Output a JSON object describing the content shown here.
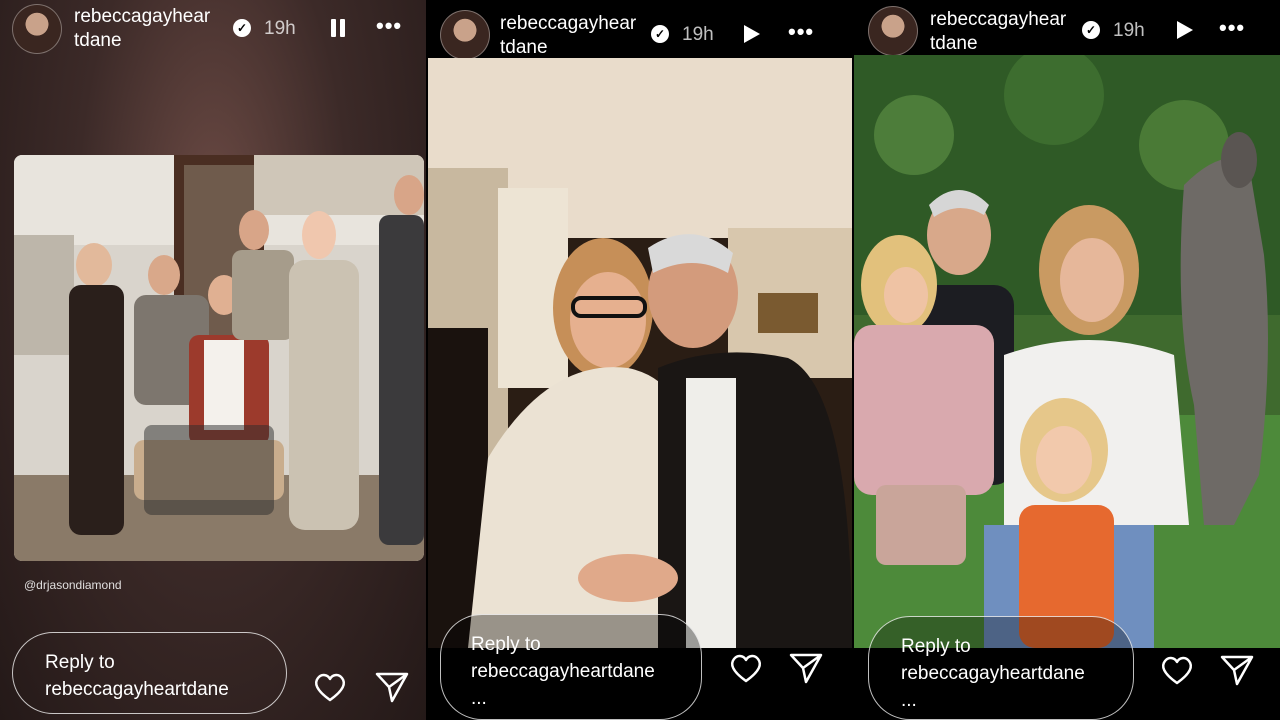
{
  "stories": [
    {
      "username": "rebeccagayheartdane",
      "username_line1": "rebeccagayhear",
      "username_line2": "tdane",
      "verified_icon": "verified-badge-icon",
      "time": "19h",
      "playback": "pause-icon",
      "more_icon": "more-options-icon",
      "photo_credit": "@drjasondiamond",
      "reply_line1": "Reply to",
      "reply_line2": "rebeccagayheartdane",
      "reply_line3": "",
      "like_icon": "heart-icon",
      "share_icon": "send-icon"
    },
    {
      "username": "rebeccagayheartdane",
      "username_line1": "rebeccagayhear",
      "username_line2": "tdane",
      "verified_icon": "verified-badge-icon",
      "time": "19h",
      "playback": "play-icon",
      "more_icon": "more-options-icon",
      "reply_line1": "Reply to",
      "reply_line2": "rebeccagayheartdane",
      "reply_line3": "...",
      "like_icon": "heart-icon",
      "share_icon": "send-icon"
    },
    {
      "username": "rebeccagayheartdane",
      "username_line1": "rebeccagayhear",
      "username_line2": "tdane",
      "verified_icon": "verified-badge-icon",
      "time": "19h",
      "playback": "play-icon",
      "more_icon": "more-options-icon",
      "reply_line1": "Reply to",
      "reply_line2": "rebeccagayheartdane",
      "reply_line3": "...",
      "like_icon": "heart-icon",
      "share_icon": "send-icon"
    }
  ]
}
